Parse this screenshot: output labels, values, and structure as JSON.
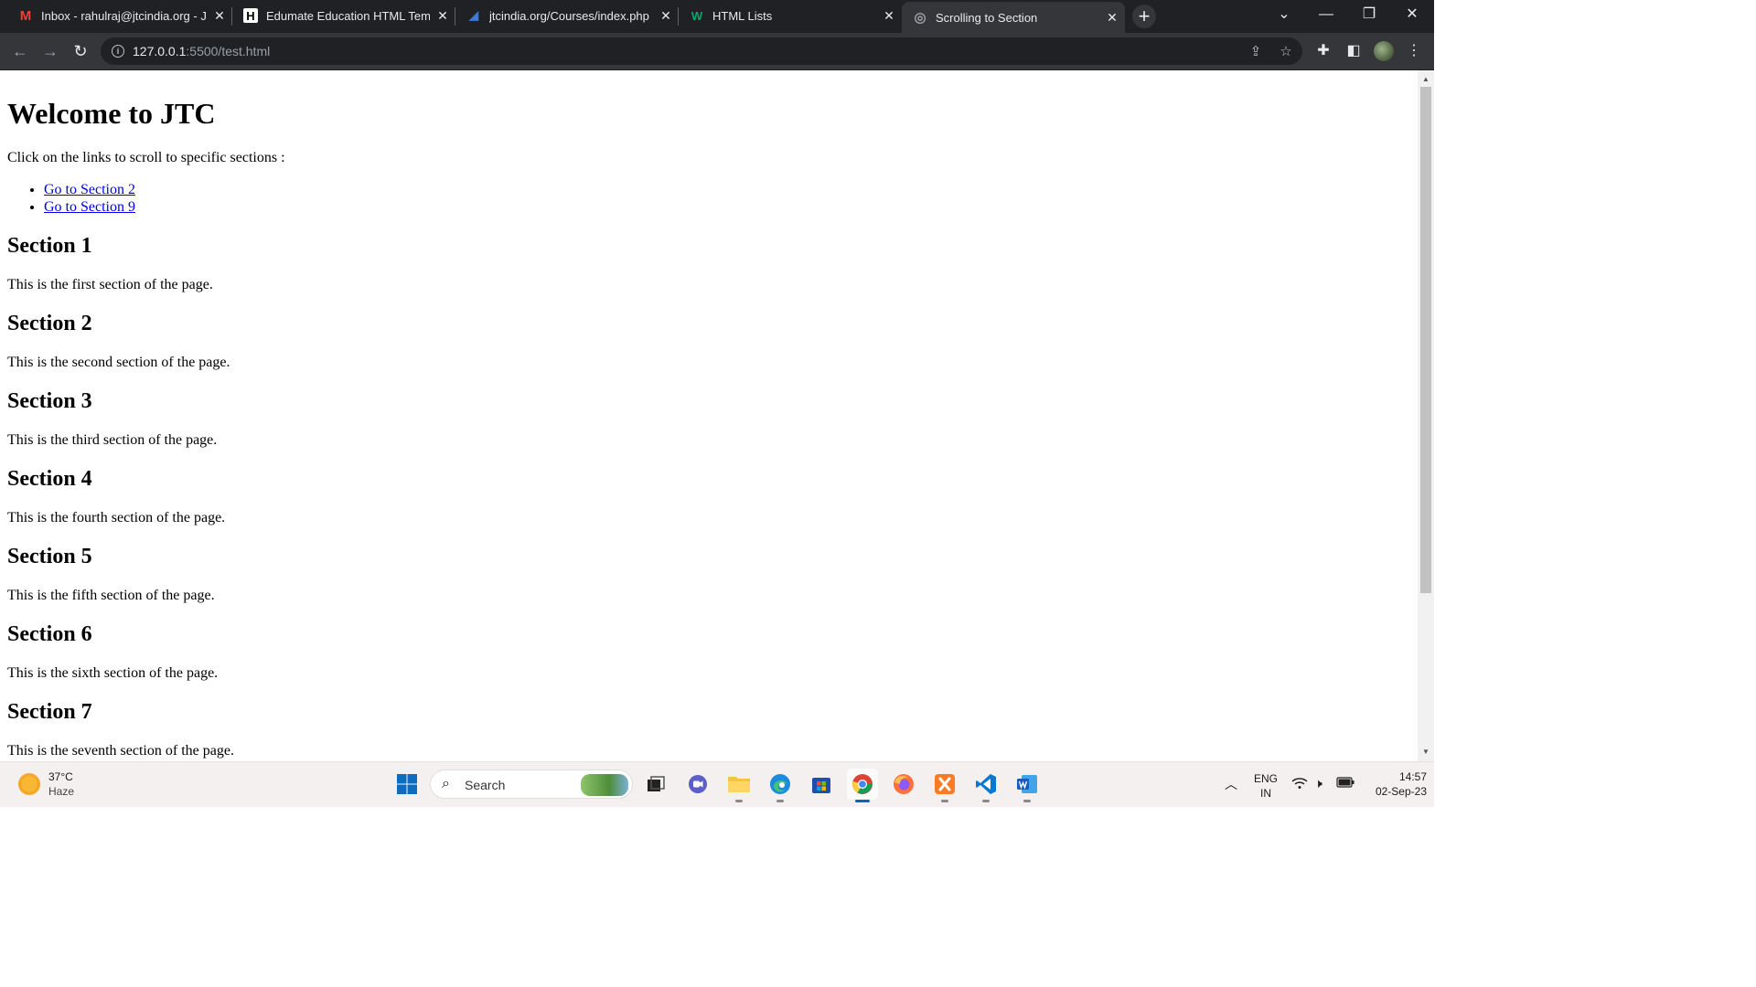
{
  "browser": {
    "tabs": [
      {
        "title": "Inbox - rahulraj@jtcindia.org - JT",
        "favicon": "gmail-icon",
        "active": false
      },
      {
        "title": "Edumate Education HTML Templa",
        "favicon": "h-logo-icon",
        "active": false
      },
      {
        "title": "jtcindia.org/Courses/index.php",
        "favicon": "jtc-icon",
        "active": false
      },
      {
        "title": "HTML Lists",
        "favicon": "w3schools-icon",
        "active": false
      },
      {
        "title": "Scrolling to Section",
        "favicon": "globe-icon",
        "active": true
      }
    ],
    "url_host": "127.0.0.1",
    "url_rest": ":5500/test.html"
  },
  "page": {
    "heading": "Welcome to JTC",
    "intro": "Click on the links to scroll to specific sections :",
    "links": [
      {
        "label": "Go to Section 2"
      },
      {
        "label": "Go to Section 9"
      }
    ],
    "sections": [
      {
        "title": "Section 1",
        "text": "This is the first section of the page."
      },
      {
        "title": "Section 2",
        "text": "This is the second section of the page."
      },
      {
        "title": "Section 3",
        "text": "This is the third section of the page."
      },
      {
        "title": "Section 4",
        "text": "This is the fourth section of the page."
      },
      {
        "title": "Section 5",
        "text": "This is the fifth section of the page."
      },
      {
        "title": "Section 6",
        "text": "This is the sixth section of the page."
      },
      {
        "title": "Section 7",
        "text": "This is the seventh section of the page."
      }
    ],
    "scroll_fraction_visible": 0.77
  },
  "taskbar": {
    "weather_temp": "37°C",
    "weather_cond": "Haze",
    "search_label": "Search",
    "lang_top": "ENG",
    "lang_bottom": "IN",
    "time": "14:57",
    "date": "02-Sep-23"
  },
  "colors": {
    "link": "#0000ee",
    "tabstrip": "#202124",
    "toolbar": "#35363a",
    "taskbar": "#f3f0ef"
  }
}
